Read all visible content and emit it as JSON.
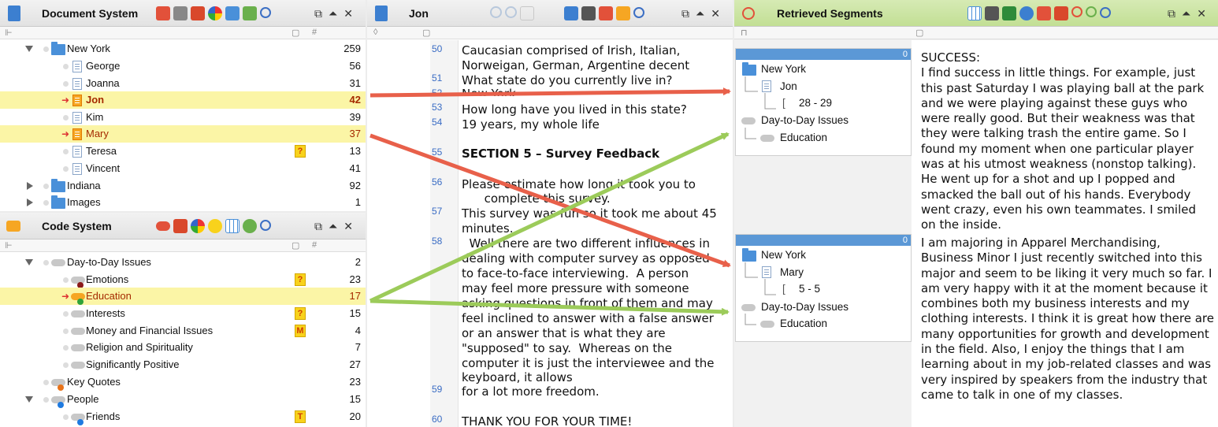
{
  "document_system": {
    "title": "Document System",
    "rows": [
      {
        "label": "New York",
        "count": "259"
      },
      {
        "label": "George",
        "count": "56"
      },
      {
        "label": "Joanna",
        "count": "31"
      },
      {
        "label": "Jon",
        "count": "42"
      },
      {
        "label": "Kim",
        "count": "39"
      },
      {
        "label": "Mary",
        "count": "37"
      },
      {
        "label": "Teresa",
        "count": "13"
      },
      {
        "label": "Vincent",
        "count": "41"
      },
      {
        "label": "Indiana",
        "count": "92"
      },
      {
        "label": "Images",
        "count": "1"
      }
    ],
    "memo_icon": "?"
  },
  "code_system": {
    "title": "Code System",
    "rows": [
      {
        "label": "Day-to-Day Issues",
        "count": "2"
      },
      {
        "label": "Emotions",
        "count": "23",
        "memo": "?"
      },
      {
        "label": "Education",
        "count": "17"
      },
      {
        "label": "Interests",
        "count": "15",
        "memo": "?"
      },
      {
        "label": "Money and Financial Issues",
        "count": "4",
        "memo": "M"
      },
      {
        "label": "Religion and Spirituality",
        "count": "7"
      },
      {
        "label": "Significantly Positive",
        "count": "27"
      },
      {
        "label": "Key Quotes",
        "count": "23"
      },
      {
        "label": "People",
        "count": "15"
      },
      {
        "label": "Friends",
        "count": "20",
        "memo": "T"
      }
    ]
  },
  "document_browser": {
    "title": "Jon",
    "line_numbers": [
      "50",
      "51",
      "52",
      "53",
      "54",
      "55",
      "56",
      "57",
      "58",
      "59",
      "60"
    ],
    "lines": [
      "Caucasian comprised of Irish, Italian,",
      "Norweigan, German, Argentine decent",
      "What state do you currently live in?",
      "New York",
      "How long have you lived in this state?",
      "19 years, my whole life",
      "SECTION 5 – Survey Feedback",
      "Please estimate how long it took you to",
      "      complete this survey.",
      "This survey was fun so it took me about 45",
      "minutes.",
      "  Well there are two different influences in",
      "dealing with computer survey as opposed",
      "to face-to-face interviewing.  A person",
      "may feel more pressure with someone",
      "asking questions in front of them and may",
      "feel inclined to answer with a false answer",
      "or an answer that is what they are",
      "\"supposed\" to say.  Whereas on the",
      "computer it is just the interviewee and the",
      "keyboard, it allows",
      "for a lot more freedom.",
      "THANK YOU FOR YOUR TIME!"
    ]
  },
  "retrieved_segments": {
    "title": "Retrieved Segments",
    "segments": [
      {
        "weight": "0",
        "group": "New York",
        "doc": "Jon",
        "range": "28 - 29",
        "code_parent": "Day-to-Day Issues",
        "code": "Education",
        "text": "SUCCESS:\nI find success in little things.  For example, just this past Saturday I was playing ball at the park and we were playing against these guys who were really good.  But their weakness was that they were talking trash the entire game.  So I found my moment when one particular player was at his utmost weakness (nonstop talking). He went up for a shot and up I popped and smacked the ball out of his hands.  Everybody went crazy, even his own teammates.  I smiled on the inside."
      },
      {
        "weight": "0",
        "group": "New York",
        "doc": "Mary",
        "range": "5 - 5",
        "code_parent": "Day-to-Day Issues",
        "code": "Education",
        "text": "I am majoring in Apparel Merchandising, Business Minor I just recently switched into this major and seem to be liking it very much so far. I am very happy with it at the moment because it combines both my business interests and my clothing interests. I think it is great how there are many opportunities for growth and development in the field. Also, I enjoy the things that I am learning about in my job-related classes and was very inspired by speakers from the industry that came to talk in one of my classes."
      }
    ]
  },
  "colors": {
    "highlight": "#fbf5a6",
    "red_arrow": "#e8604a",
    "green_arrow": "#9ccb5a",
    "retrieved_header": "#c7e19c",
    "folder": "#4a90d9"
  }
}
